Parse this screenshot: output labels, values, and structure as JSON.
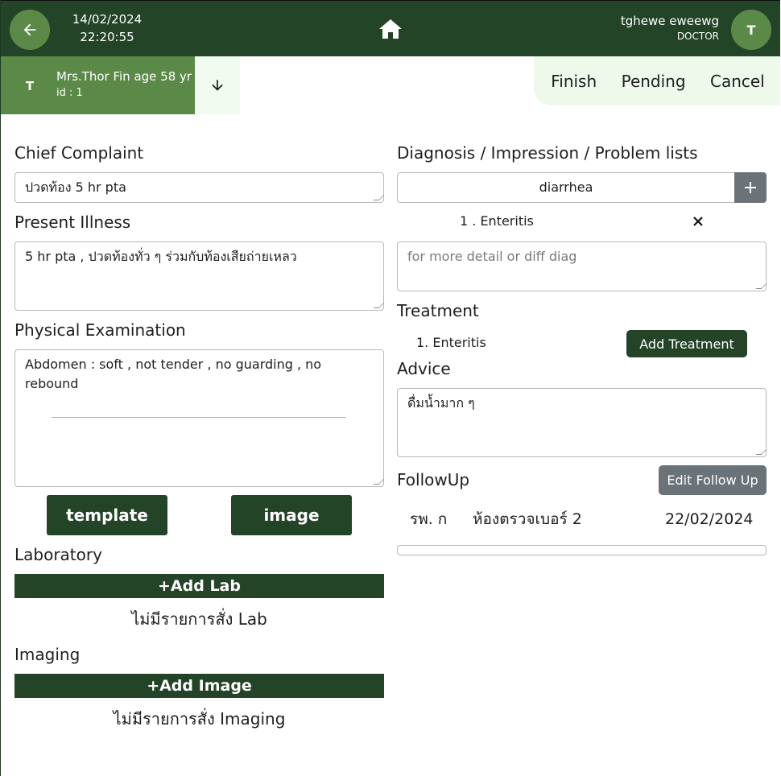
{
  "header": {
    "date": "14/02/2024",
    "time": "22:20:55",
    "user_name": "tghewe eweewg",
    "user_role": "DOCTOR",
    "user_initial": "T",
    "icons": {
      "back": "arrow-left-icon",
      "home": "home-icon"
    }
  },
  "patient": {
    "initial": "T",
    "name": "Mrs.Thor Fin age 58 yr",
    "id_label": "id : 1",
    "expand_icon": "arrow-down-icon"
  },
  "actions": {
    "finish": "Finish",
    "pending": "Pending",
    "cancel": "Cancel"
  },
  "left": {
    "chief_complaint": {
      "label": "Chief Complaint",
      "value": "ปวดท้อง 5 hr pta"
    },
    "present_illness": {
      "label": "Present Illness",
      "value": "5 hr pta , ปวดท้องทั่ว ๆ ร่วมกับท้องเสียถ่ายเหลว"
    },
    "physical_exam": {
      "label": "Physical Examination",
      "value": "Abdomen : soft , not tender , no guarding , no rebound"
    },
    "template_button": "template",
    "image_button": "image",
    "laboratory": {
      "label": "Laboratory",
      "add_button": "+Add Lab",
      "empty_text": "ไม่มีรายการสั่ง Lab"
    },
    "imaging": {
      "label": "Imaging",
      "add_button": "+Add Image",
      "empty_text": "ไม่มีรายการสั่ง Imaging"
    }
  },
  "right": {
    "diagnosis": {
      "label": "Diagnosis / Impression / Problem lists",
      "search_value": "diarrhea",
      "add_icon": "plus-icon",
      "items": [
        {
          "text": "1 . Enteritis",
          "remove_icon": "close-icon"
        }
      ],
      "detail_placeholder": "for more detail or diff diag"
    },
    "treatment": {
      "label": "Treatment",
      "items": [
        {
          "text": "1. Enteritis"
        }
      ],
      "add_button": "Add Treatment"
    },
    "advice": {
      "label": "Advice",
      "value": "ดื่มน้ำมาก ๆ"
    },
    "followup": {
      "label": "FollowUp",
      "edit_button": "Edit Follow Up",
      "hospital": "รพ. ก",
      "room": "ห้องตรวจเบอร์ 2",
      "date": "22/02/2024"
    }
  },
  "colors": {
    "header_bg": "#244428",
    "accent_green": "#5b8a48",
    "light_green": "#eef9ec",
    "grey_button": "#6b7278"
  }
}
